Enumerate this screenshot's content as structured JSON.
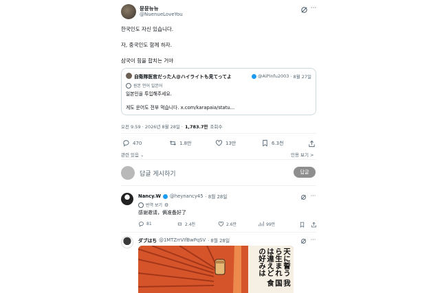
{
  "post": {
    "display_name": "뮨뮨뉴뉴",
    "handle": "@NuenueLoveYou",
    "lines": [
      "한국인도 자신 있습니다.",
      "자, 중국인도 함께 하자.",
      "삼국이 힘을 합치는 거야"
    ],
    "timestamp": "오전 9:59 · 2026년 8월 28일 ·",
    "views_count": "1,783.7만",
    "views_label": "조회수",
    "metrics": {
      "replies": "470",
      "reposts": "1.8만",
      "likes": "13만",
      "bookmarks": "6.3천"
    },
    "related_label": "관련 있음 ⌄",
    "quote_reposts_label": "인용 보기 >"
  },
  "quoted": {
    "display_name": "自衛隊医官だった人@ハイライトも見てってよ",
    "handle": "@AiPinfu2003",
    "date": "· 8월 27일",
    "translated_note": "원본 언어 일본어",
    "text1": "일본인을 투입해주세요.",
    "text2": "게도 운어도 전부 먹습니다. x.com/karapaia/statu..."
  },
  "reply_box": {
    "placeholder": "답글 게시하기",
    "button": "답글"
  },
  "reply1": {
    "display_name": "Nancy.W",
    "handle": "@heynancy45",
    "date": "· 8월 28일",
    "translate_label": "번역 보기",
    "text": "感谢邀请，俩准备好了",
    "metrics": {
      "replies": "81",
      "reposts": "2.4천",
      "likes": "2.6만",
      "views": "99만"
    }
  },
  "reply2": {
    "display_name": "ダブはち",
    "handle": "@1MTZrrVIfBwPqSV",
    "date": "· 8월 28일",
    "image_text": "天に誓う 我ら生まれ 国は違えど 食の好みは"
  }
}
